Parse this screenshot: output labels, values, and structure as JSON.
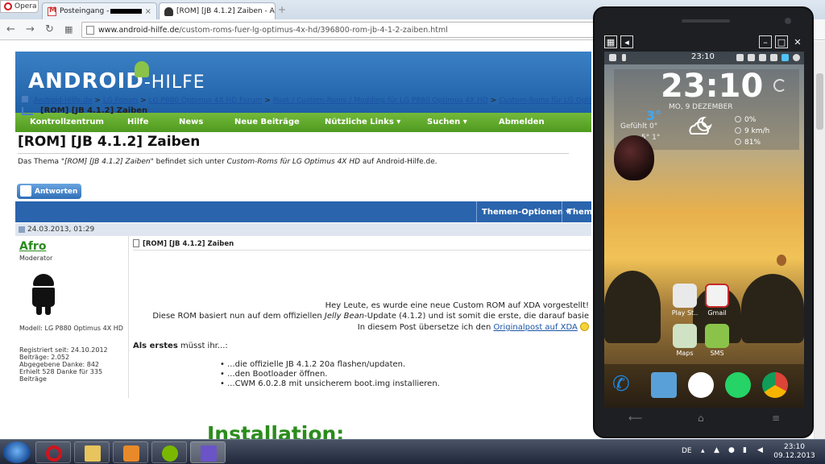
{
  "browser": {
    "opera_label": "Opera",
    "tabs": [
      {
        "label": "Posteingang -",
        "close": "×"
      },
      {
        "label": "[ROM] [JB 4.1.2] Zaiben - A",
        "close": "×"
      }
    ],
    "new_tab": "+",
    "url_domain": "www.android-hilfe.de",
    "url_path": "/custom-roms-fuer-lg-optimus-4x-hd/396800-rom-jb-4-1-2-zaiben.html"
  },
  "site": {
    "logo_text": "ANDROID",
    "logo_suffix": "-HILFE",
    "nav": [
      "Kontrollzentrum",
      "Hilfe",
      "News",
      "Neue Beiträge",
      "Nützliche Links ▾",
      "Suchen ▾",
      "Abmelden"
    ],
    "breadcrumb": [
      "Android-Hilfe.de",
      "LG Forum",
      "LG P880 Optimus 4X HD Forum",
      "Root / Custom-Roms / Modding für LG P880 Optimus 4X HD",
      "Custom-Roms für LG Optimus 4X"
    ],
    "breadcrumb_sep": ">",
    "current_crumb": "[ROM] [JB 4.1.2] Zaiben",
    "thread_title": "[ROM] [JB 4.1.2] Zaiben",
    "desc_prefix": "Das Thema \"",
    "desc_thread": "[ROM] [JB 4.1.2] Zaiben",
    "desc_mid": "\" befindet sich unter ",
    "desc_forum": "Custom-Roms für LG Optimus 4X HD",
    "desc_suffix": " auf Android-Hilfe.de.",
    "reply_button": "Antworten",
    "thread_options": [
      "Themen-Optionen ▾",
      "Thema"
    ]
  },
  "post": {
    "date": "24.03.2013, 01:29",
    "author": "Afro",
    "role": "Moderator",
    "model": "Modell: LG P880 Optimus 4X HD",
    "registered": "Registriert seit: 24.10.2012",
    "posts": "Beiträge: 2.052",
    "thanks_given": "Abgegebene Danke: 842",
    "thanks_received": "Erhielt 528 Danke für 335 Beiträge",
    "title": "[ROM] [JB 4.1.2] Zaiben",
    "line1": "Hey Leute, es wurde eine neue Custom ROM auf XDA vorgestellt!",
    "line2_a": "Diese ROM basiert nun auf dem offiziellen ",
    "line2_em": "Jelly Bean",
    "line2_b": "-Update (4.1.2) und ist somit die erste, die darauf basie",
    "line3_a": "In diesem Post übersetze ich den ",
    "line3_link": "Originalpost auf XDA",
    "first_bold": "Als erstes",
    "first_rest": " müsst ihr...:",
    "bullets": [
      "...die offizielle JB 4.1.2 20a flashen/updaten.",
      "...den Bootloader öffnen.",
      "...CWM 6.0.2.8 mit unsicherem boot.img installieren."
    ],
    "install_heading": "Installation:"
  },
  "phone": {
    "status_time": "23:10",
    "clock": "23:10",
    "date": "MO, 9 DEZEMBER",
    "temp": "3°",
    "feels": "Gefühlt 0°",
    "range": "5° 1°",
    "rain": "0%",
    "wind": "9 km/h",
    "humidity": "81%",
    "apps": [
      {
        "label": "Play St..",
        "color": "#e9e9e9"
      },
      {
        "label": "Gmail",
        "color": "#f2f2f2"
      },
      {
        "label": "Maps",
        "color": "#cfe3c4"
      },
      {
        "label": "SMS",
        "color": "#8bc34a"
      }
    ],
    "dock_colors": [
      "#1e88e5",
      "#5aa0d8",
      "#ffffff",
      "#25d366",
      "#e8b418"
    ],
    "window_controls": [
      "–",
      "□",
      "✕"
    ]
  },
  "taskbar": {
    "lang": "DE",
    "clock_time": "23:10",
    "clock_date": "09.12.2013"
  }
}
